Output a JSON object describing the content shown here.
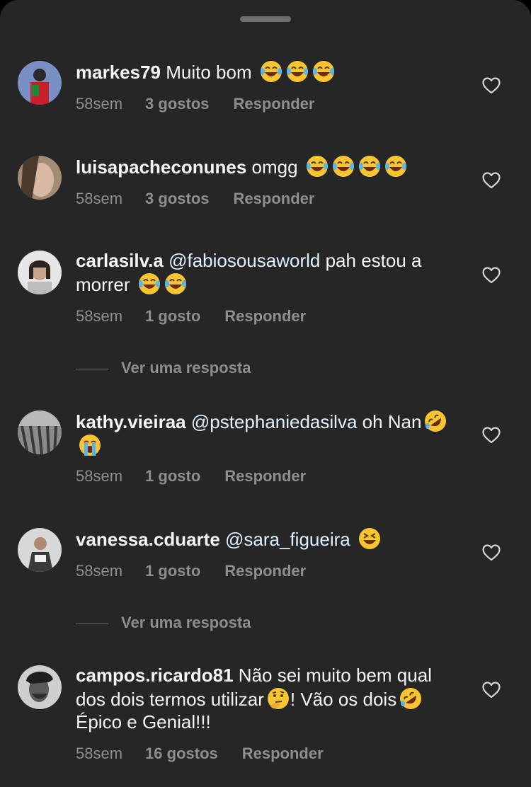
{
  "comments": [
    {
      "username": "markes79",
      "parts": [
        {
          "t": "text",
          "v": " Muito bom "
        }
      ],
      "emoji": [
        "joy",
        "joy",
        "joy"
      ],
      "emoji_after": true,
      "time": "58sem",
      "likes": "3 gostos",
      "reply": "Responder"
    },
    {
      "username": "luisapacheconunes",
      "parts": [
        {
          "t": "text",
          "v": " omgg "
        }
      ],
      "emoji": [
        "joy",
        "joy",
        "joy",
        "joy"
      ],
      "time": "58sem",
      "likes": "3 gostos",
      "reply": "Responder"
    },
    {
      "username": "carlasilv.a",
      "mention": "@fabiosousaworld",
      "text_after": " pah estou a morrer ",
      "emoji": [
        "joy",
        "joy"
      ],
      "time": "58sem",
      "likes": "1 gosto",
      "reply": "Responder"
    },
    {
      "username": "kathy.vieiraa",
      "mention": "@pstephaniedasilva",
      "text_after": " oh Nan",
      "emoji": [
        "rofl",
        "sob"
      ],
      "time": "58sem",
      "likes": "1 gosto",
      "reply": "Responder"
    },
    {
      "username": "vanessa.cduarte",
      "mention": "@sara_figueira",
      "text_after": " ",
      "emoji": [
        "laughing"
      ],
      "time": "58sem",
      "likes": "1 gosto",
      "reply": "Responder"
    },
    {
      "username": "campos.ricardo81",
      "text_a": " Não sei muito bem qual dos dois termos utilizar",
      "text_b": "! Vão os dois",
      "text_c": " Épico e Genial!!!",
      "emoji": [
        "thinking",
        "rofl"
      ],
      "time": "58sem",
      "likes": "16 gostos",
      "reply": "Responder"
    }
  ],
  "view_replies_1": "Ver uma resposta",
  "view_replies_2": "Ver uma resposta",
  "colors": {
    "sheet": "#262626",
    "secondary": "#8e8e8e",
    "mention": "#e0f1ff"
  }
}
